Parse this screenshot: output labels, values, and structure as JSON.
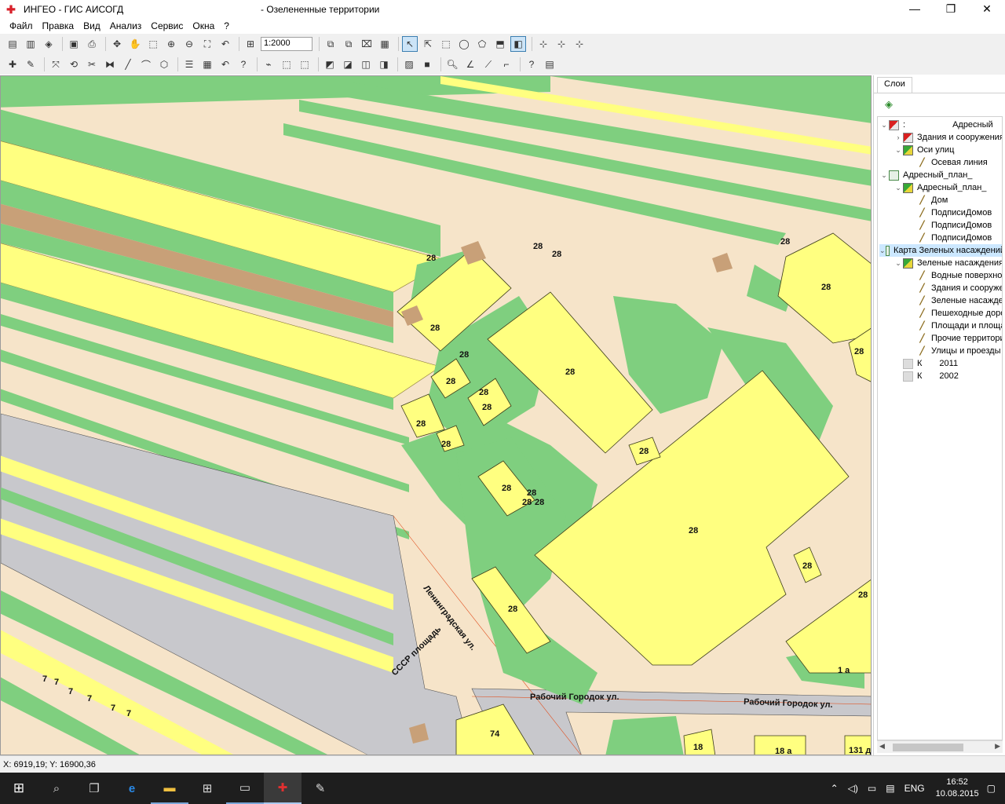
{
  "window": {
    "app_title": "ИНГЕО - ГИС АИСОГД",
    "document_title": "- Озелененные территории",
    "minimize": "—",
    "maximize": "❐",
    "close": "✕"
  },
  "menu": [
    "Файл",
    "Правка",
    "Вид",
    "Анализ",
    "Сервис",
    "Окна",
    "?"
  ],
  "toolbar": {
    "scale": "1:2000"
  },
  "map": {
    "labels": {
      "l1": "28",
      "l2": "28",
      "l3": "28",
      "l4": "28",
      "l5": "28",
      "l6": "28",
      "l7": "28",
      "l8": "28",
      "l9": "28",
      "l10": "28",
      "l11": "28",
      "l12": "28",
      "l13": "28",
      "l14": "28",
      "l15": "28",
      "l16": "28",
      "l17": "28",
      "l18": "28",
      "l19": "28",
      "l20": "28",
      "l21": "28",
      "l22": "28",
      "l23": "28",
      "l24": "1 а",
      "l25": "74",
      "l26": "18",
      "l27": "18 а",
      "l28": "131 д",
      "s1": "7",
      "s2": "7",
      "s3": "7",
      "s4": "7",
      "s5": "7",
      "s6": "7"
    },
    "streets": {
      "leningradskaya": "Ленинградская ул.",
      "rabochiy1": "Рабочий Городок ул.",
      "rabochiy2": "Рабочий Городок ул.",
      "sssr": "СССР площадь"
    }
  },
  "panel": {
    "tab": "Слои",
    "tree": [
      {
        "label": "Адресный",
        "truncated_prefix": ":"
      },
      {
        "label": "Здания и сооружения"
      },
      {
        "label": "Оси улиц"
      },
      {
        "label": "Осевая линия"
      },
      {
        "label": "Адресный_план_"
      },
      {
        "label": "Адресный_план_"
      },
      {
        "label": "Дом"
      },
      {
        "label": "ПодписиДомов"
      },
      {
        "label": "ПодписиДомов"
      },
      {
        "label": "ПодписиДомов"
      },
      {
        "label": "Карта Зеленых насаждений"
      },
      {
        "label": "Зеленые насаждения"
      },
      {
        "label": "Водные поверхности"
      },
      {
        "label": "Здания и сооружения"
      },
      {
        "label": "Зеленые насаждения"
      },
      {
        "label": "Пешеходные дорожки"
      },
      {
        "label": "Площади и площадки"
      },
      {
        "label": "Прочие территории"
      },
      {
        "label": "Улицы и проезды"
      },
      {
        "label": "К",
        "extra": "2011"
      },
      {
        "label": "К",
        "extra": "2002"
      }
    ]
  },
  "status": {
    "coords": "X: 6919,19; Y: 16900,36"
  },
  "taskbar": {
    "language": "ENG",
    "time": "16:52",
    "date": "10.08.2015"
  },
  "colors": {
    "map_background": "#f6e4c9",
    "green_area": "#7fcf7f",
    "building": "#ffff80",
    "road": "#c8c8cc",
    "brown": "#c8a078",
    "selection": "#cce8ff"
  }
}
